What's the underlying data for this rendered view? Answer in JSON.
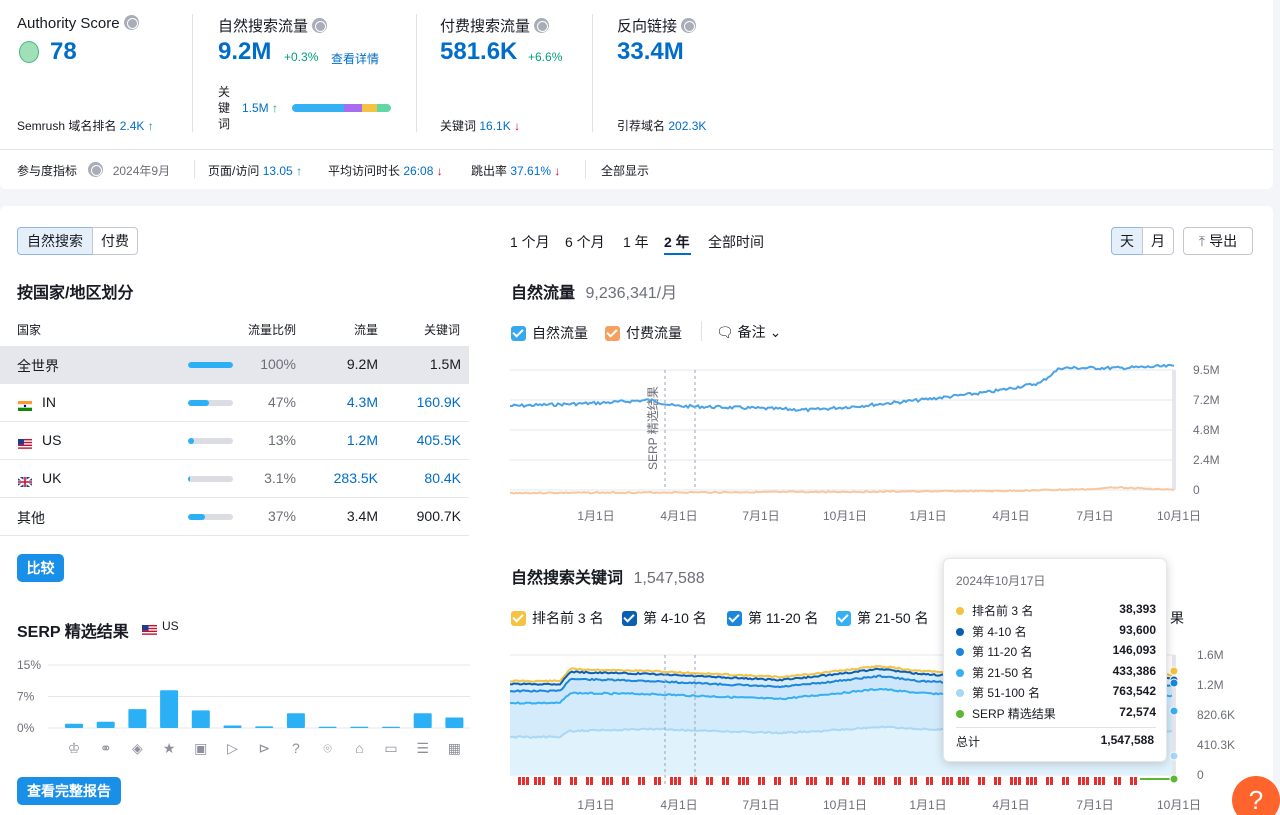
{
  "metrics": {
    "authority": {
      "title": "Authority Score",
      "value": "78",
      "sub_label": "Semrush 域名排名",
      "sub_value": "2.4K",
      "sub_arrow": "↑"
    },
    "organic": {
      "title": "自然搜索流量",
      "value": "9.2M",
      "delta": "+0.3%",
      "link": "查看详情",
      "kw_label": "关\n键\n词",
      "kw_value": "1.5M",
      "kw_arrow": "↑"
    },
    "paid": {
      "title": "付费搜索流量",
      "value": "581.6K",
      "delta": "+6.6%",
      "sub_label": "关键词",
      "sub_value": "16.1K",
      "sub_arrow": "↓"
    },
    "backlinks": {
      "title": "反向链接",
      "value": "33.4M",
      "sub_label": "引荐域名",
      "sub_value": "202.3K"
    }
  },
  "engagement": {
    "label": "参与度指标",
    "date": "2024年9月",
    "pages_label": "页面/访问",
    "pages_value": "13.05",
    "pages_arrow": "↑",
    "duration_label": "平均访问时长",
    "duration_value": "26:08",
    "duration_arrow": "↓",
    "bounce_label": "跳出率",
    "bounce_value": "37.61%",
    "bounce_arrow": "↓",
    "show_all": "全部显示"
  },
  "left": {
    "tabs": [
      "自然搜索",
      "付费"
    ],
    "country_title": "按国家/地区划分",
    "columns": {
      "country": "国家",
      "share": "流量比例",
      "traffic": "流量",
      "keywords": "关键词"
    },
    "rows": [
      {
        "name": "全世界",
        "share": "100%",
        "share_frac": 1.0,
        "traffic": "9.2M",
        "keywords": "1.5M"
      },
      {
        "name": "IN",
        "share": "47%",
        "share_frac": 0.47,
        "traffic": "4.3M",
        "keywords": "160.9K"
      },
      {
        "name": "US",
        "share": "13%",
        "share_frac": 0.13,
        "traffic": "1.2M",
        "keywords": "405.5K"
      },
      {
        "name": "UK",
        "share": "3.1%",
        "share_frac": 0.031,
        "traffic": "283.5K",
        "keywords": "80.4K"
      },
      {
        "name": "其他",
        "share": "37%",
        "share_frac": 0.37,
        "traffic": "3.4M",
        "keywords": "900.7K"
      }
    ],
    "compare_button": "比较",
    "serp_title": "SERP 精选结果",
    "serp_country": "US",
    "full_report_button": "查看完整报告"
  },
  "serp_chart": {
    "type": "bar",
    "y_ticks": [
      "15%",
      "7%",
      "0%"
    ],
    "ylim": [
      0,
      15
    ],
    "values": [
      1,
      1.5,
      4.5,
      9,
      4.2,
      0.6,
      0.4,
      3.5,
      0.3,
      0.3,
      0.3,
      3.5,
      2.5
    ],
    "icons": [
      "crown-icon",
      "link-icon",
      "diamond-icon",
      "star-icon",
      "image-icon",
      "video-icon",
      "play-icon",
      "question-icon",
      "pin-icon",
      "graduation-icon",
      "comment-icon",
      "list-icon",
      "gallery-icon"
    ]
  },
  "range_tabs": [
    "1 个月",
    "6 个月",
    "1 年",
    "2 年",
    "全部时间"
  ],
  "granularity": [
    "天",
    "月"
  ],
  "export_label": "导出",
  "traffic_chart": {
    "title": "自然流量",
    "total": "9,236,341/月",
    "legend": [
      "自然流量",
      "付费流量"
    ],
    "notes_label": "备注",
    "annotation": "SERP 精选结果",
    "y_ticks": [
      "9.5M",
      "7.2M",
      "4.8M",
      "2.4M",
      "0"
    ],
    "x_ticks": [
      "1月1日",
      "4月1日",
      "7月1日",
      "10月1日",
      "1月1日",
      "4月1日",
      "7月1日",
      "10月1日"
    ],
    "colors": {
      "organic": "#4aa3e6",
      "paid": "#f7c79f"
    }
  },
  "keywords_chart": {
    "title": "自然搜索关键词",
    "total": "1,547,588",
    "legend": [
      "排名前 3 名",
      "第 4-10 名",
      "第 11-20 名",
      "第 21-50 名",
      "第 51-100 名"
    ],
    "legend_tail": "果",
    "y_ticks": [
      "1.6M",
      "1.2M",
      "820.6K",
      "410.3K",
      "0"
    ],
    "x_ticks": [
      "1月1日",
      "4月1日",
      "7月1日",
      "10月1日",
      "1月1日",
      "4月1日",
      "7月1日",
      "10月1日"
    ]
  },
  "tooltip": {
    "date": "2024年10月17日",
    "rows": [
      {
        "label": "排名前 3 名",
        "value": "38,393",
        "color": "#f5c244"
      },
      {
        "label": "第 4-10 名",
        "value": "93,600",
        "color": "#0a5fb0"
      },
      {
        "label": "第 11-20 名",
        "value": "146,093",
        "color": "#1a86dc"
      },
      {
        "label": "第 21-50 名",
        "value": "433,386",
        "color": "#35b0f2"
      },
      {
        "label": "第 51-100 名",
        "value": "763,542",
        "color": "#a8d8f7"
      },
      {
        "label": "SERP 精选结果",
        "value": "72,574",
        "color": "#5bb830"
      }
    ],
    "total_label": "总计",
    "total_value": "1,547,588"
  }
}
